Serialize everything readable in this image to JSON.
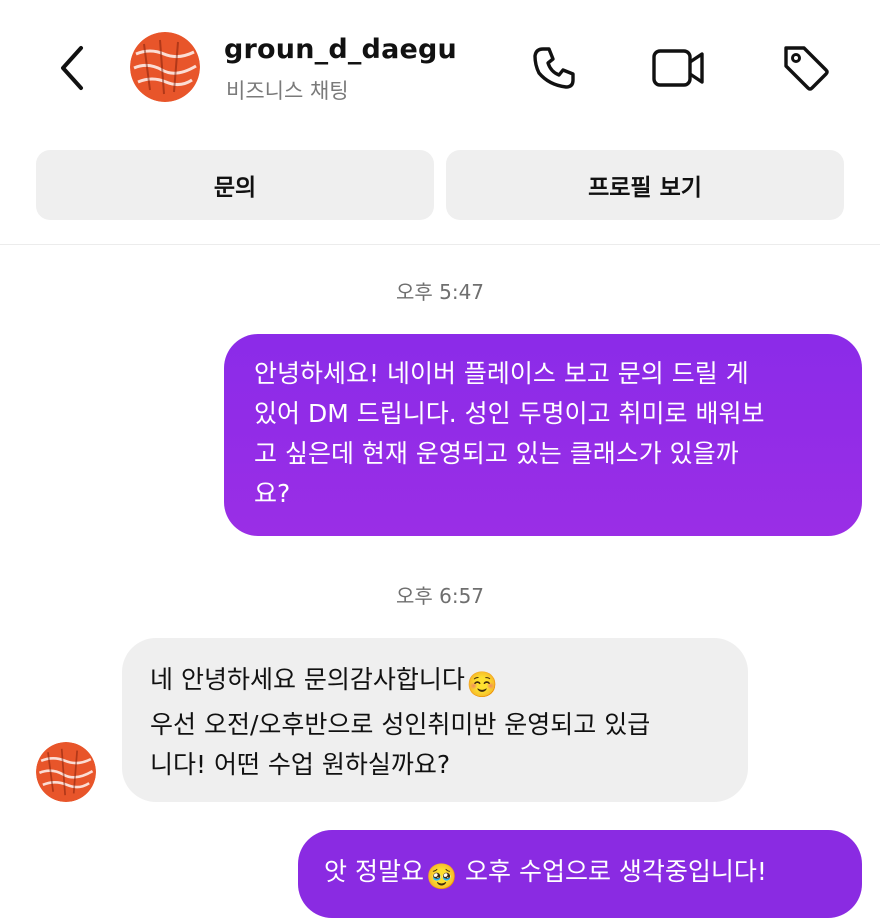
{
  "header": {
    "account_name": "groun_d_daegu",
    "subtitle": "비즈니스 채팅",
    "icons": [
      "back-icon",
      "phone-icon",
      "video-icon",
      "tag-icon"
    ]
  },
  "actions": {
    "inquiry_label": "문의",
    "profile_label": "프로필 보기"
  },
  "messages": {
    "ts1": "오후 5:47",
    "ts2": "오후 6:57",
    "out1": {
      "lines": [
        "안녕하세요! 네이버 플레이스 보고 문의 드릴 게",
        "있어 DM 드립니다. 성인 두명이고 취미로 배워보",
        "고 싶은데 현재 운영되고 있는 클래스가 있을까",
        "요?"
      ]
    },
    "in1": {
      "line1": "네 안녕하세요 문의감사합니다",
      "line1_emoji": "☺️",
      "line2": "우선 오전/오후반으로 성인취미반 운영되고 있급",
      "line3": "니다! 어떤 수업 원하실까요?"
    },
    "out2": {
      "before": "앗 정말요",
      "emoji": "🥹",
      "after": " 오후 수업으로 생각중입니다!"
    }
  },
  "colors": {
    "outgoing_bubble": "#8b2be8",
    "incoming_bubble": "#efefef",
    "pill_bg": "#efefef",
    "avatar_orange": "#e8552a"
  }
}
